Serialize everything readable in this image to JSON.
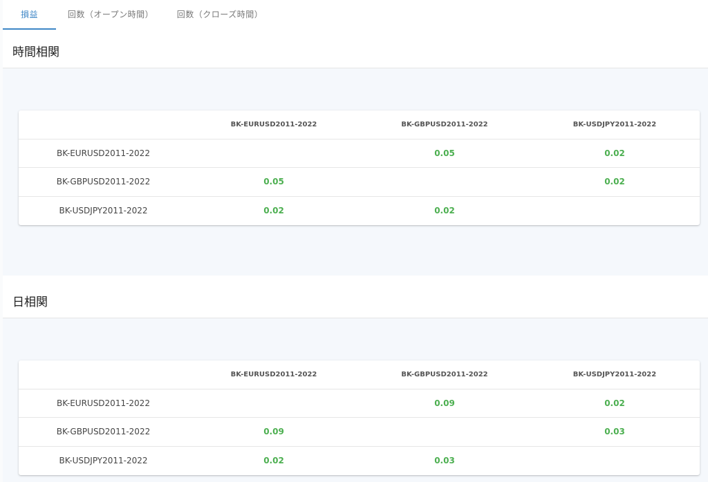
{
  "tabs": [
    {
      "label": "損益",
      "active": true
    },
    {
      "label": "回数（オープン時間）",
      "active": false
    },
    {
      "label": "回数（クローズ時間）",
      "active": false
    }
  ],
  "colors": {
    "accent": "#3d86c6",
    "positive": "#4caf50"
  },
  "sections": [
    {
      "title": "時間相関",
      "columns": [
        "",
        "BK-EURUSD2011-2022",
        "BK-GBPUSD2011-2022",
        "BK-USDJPY2011-2022"
      ],
      "rows": [
        {
          "label": "BK-EURUSD2011-2022",
          "cells": [
            "",
            "0.05",
            "0.02"
          ]
        },
        {
          "label": "BK-GBPUSD2011-2022",
          "cells": [
            "0.05",
            "",
            "0.02"
          ]
        },
        {
          "label": "BK-USDJPY2011-2022",
          "cells": [
            "0.02",
            "0.02",
            ""
          ]
        }
      ]
    },
    {
      "title": "日相関",
      "columns": [
        "",
        "BK-EURUSD2011-2022",
        "BK-GBPUSD2011-2022",
        "BK-USDJPY2011-2022"
      ],
      "rows": [
        {
          "label": "BK-EURUSD2011-2022",
          "cells": [
            "",
            "0.09",
            "0.02"
          ]
        },
        {
          "label": "BK-GBPUSD2011-2022",
          "cells": [
            "0.09",
            "",
            "0.03"
          ]
        },
        {
          "label": "BK-USDJPY2011-2022",
          "cells": [
            "0.02",
            "0.03",
            ""
          ]
        }
      ]
    }
  ]
}
